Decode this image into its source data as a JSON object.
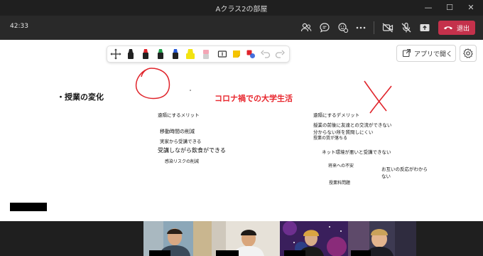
{
  "window": {
    "title": "Aクラス2の部屋",
    "minimize": "—",
    "maximize": "☐",
    "close": "✕"
  },
  "meeting": {
    "timer": "42:33",
    "icons": [
      "people-icon",
      "chat-icon",
      "reactions-icon",
      "more-icon",
      "camera-off-icon",
      "mic-off-icon",
      "share-icon",
      "leave-phone-icon"
    ],
    "leave_label": "退出"
  },
  "whiteboard": {
    "tools": [
      "move-icon",
      "black-pen-icon",
      "red-pen-icon",
      "green-pen-icon",
      "blue-pen-icon",
      "highlighter-icon",
      "eraser-icon",
      "text-icon",
      "sticky-note-icon",
      "shape-icon",
      "undo-icon",
      "redo-icon"
    ],
    "open_app_label": "アプリで開く",
    "heading_left": "・授業の変化",
    "heading_center": "コロナ禍での大学生活",
    "merits_title": "遠隔にするメリット",
    "merits": [
      "移動時間の削減",
      "実家から受講できる",
      "受講しながら飲食ができる",
      "感染リスクの削減"
    ],
    "demerits_title": "遠隔にするデメリット",
    "demerits": [
      "授業の前後に友達との交流ができない",
      "分からない所を質問しにくい",
      "授業の質が落ちる",
      "ネット環境が悪いと受講できない",
      "将来への不安",
      "授業料問題"
    ],
    "note_right": [
      "お互いの反応がわから",
      "ない"
    ]
  },
  "colors": {
    "leave": "#c4314b",
    "heading_red": "#e8262d",
    "ink_red": "#e0242b"
  }
}
